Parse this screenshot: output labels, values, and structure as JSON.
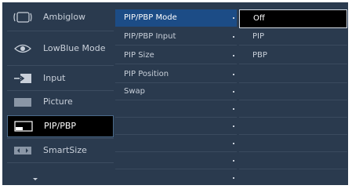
{
  "left_menu": {
    "items": [
      {
        "label": "Ambiglow",
        "icon": "ambiglow-icon"
      },
      {
        "label": "LowBlue Mode",
        "icon": "eye-icon"
      },
      {
        "label": "Input",
        "icon": "input-icon"
      },
      {
        "label": "Picture",
        "icon": "picture-icon"
      },
      {
        "label": "PIP/PBP",
        "icon": "pip-pbp-icon"
      },
      {
        "label": "SmartSize",
        "icon": "smartsize-icon"
      }
    ],
    "more_icon": "chevron-down-icon",
    "selected_index": 4
  },
  "sub_menu": {
    "items": [
      "PIP/PBP Mode",
      "PIP/PBP Input",
      "PIP Size",
      "PIP Position",
      "Swap"
    ],
    "selected_index": 0
  },
  "options": {
    "items": [
      "Off",
      "PIP",
      "PBP"
    ],
    "selected_index": 0
  },
  "colors": {
    "background": "#2a3a4e",
    "highlight": "#1c4c86",
    "selected": "#000000"
  }
}
